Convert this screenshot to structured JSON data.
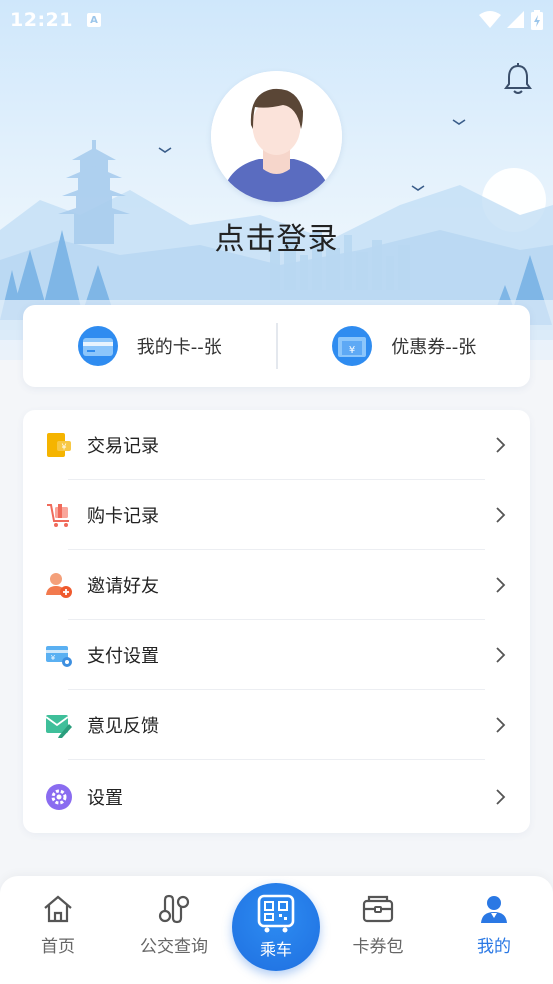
{
  "status_bar": {
    "time": "12:21",
    "badge": "A"
  },
  "profile": {
    "login_prompt": "点击登录"
  },
  "cards_panel": {
    "my_cards": "我的卡--张",
    "coupons": "优惠券--张"
  },
  "menu": {
    "items": [
      {
        "label": "交易记录",
        "icon": "transaction-icon"
      },
      {
        "label": "购卡记录",
        "icon": "cart-icon"
      },
      {
        "label": "邀请好友",
        "icon": "invite-friend-icon"
      },
      {
        "label": "支付设置",
        "icon": "payment-settings-icon"
      },
      {
        "label": "意见反馈",
        "icon": "feedback-icon"
      },
      {
        "label": "设置",
        "icon": "gear-icon"
      }
    ]
  },
  "bottom_nav": {
    "home": "首页",
    "bus_query": "公交查询",
    "ride": "乘车",
    "wallet": "卡券包",
    "mine": "我的"
  },
  "colors": {
    "accent": "#2a78e4",
    "ride_button": "#1f6fe0",
    "hero_sky": "#cfe7fb"
  }
}
